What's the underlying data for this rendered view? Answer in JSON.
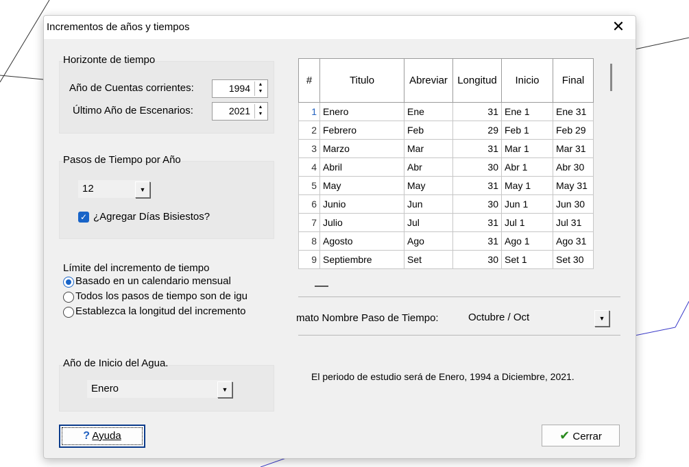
{
  "dialog": {
    "title": "Incrementos de años y tiempos",
    "close_glyph": "✕"
  },
  "horizon": {
    "group_label": "Horizonte de tiempo",
    "current_year_label": "Año de Cuentas corrientes:",
    "current_year_value": "1994",
    "last_year_label": "Último Año de Escenarios:",
    "last_year_value": "2021"
  },
  "steps": {
    "group_label": "Pasos de Tiempo por Año",
    "value": "12",
    "leap_days_label": "¿Agregar Días Bisiestos?",
    "leap_days_checked": true
  },
  "limit": {
    "group_label": "Límite del incremento de tiempo",
    "options": [
      {
        "label": "Basado en un calendario mensual",
        "selected": true
      },
      {
        "label": "Todos los pasos de tiempo son de igu",
        "selected": false
      },
      {
        "label": "Establezca la longitud del incremento",
        "selected": false
      }
    ]
  },
  "water_year": {
    "group_label": "Año de Inicio del Agua.",
    "value": "Enero"
  },
  "table": {
    "headers": [
      "#",
      "Titulo",
      "Abreviar",
      "Longitud",
      "Inicio",
      "Final"
    ],
    "rows": [
      [
        "1",
        "Enero",
        "Ene",
        "31",
        "Ene 1",
        "Ene 31"
      ],
      [
        "2",
        "Febrero",
        "Feb",
        "29",
        "Feb 1",
        "Feb 29"
      ],
      [
        "3",
        "Marzo",
        "Mar",
        "31",
        "Mar 1",
        "Mar 31"
      ],
      [
        "4",
        "Abril",
        "Abr",
        "30",
        "Abr 1",
        "Abr 30"
      ],
      [
        "5",
        "May",
        "May",
        "31",
        "May 1",
        "May 31"
      ],
      [
        "6",
        "Junio",
        "Jun",
        "30",
        "Jun 1",
        "Jun 30"
      ],
      [
        "7",
        "Julio",
        "Jul",
        "31",
        "Jul 1",
        "Jul 31"
      ],
      [
        "8",
        "Agosto",
        "Ago",
        "31",
        "Ago 1",
        "Ago 31"
      ],
      [
        "9",
        "Septiembre",
        "Set",
        "30",
        "Set 1",
        "Set 30"
      ]
    ]
  },
  "format": {
    "label": "mato Nombre Paso de Tiempo:",
    "value": "Octubre / Oct"
  },
  "summary": "El periodo de estudio será de Enero, 1994 a Diciembre, 2021.",
  "buttons": {
    "help_icon": "?",
    "help_label": "Ayuda",
    "close_icon": "✔",
    "close_label": "Cerrar"
  },
  "colors": {
    "accent": "#1864c8",
    "check_green": "#2a8a1e",
    "dialog_bg": "#f0f0f0"
  }
}
